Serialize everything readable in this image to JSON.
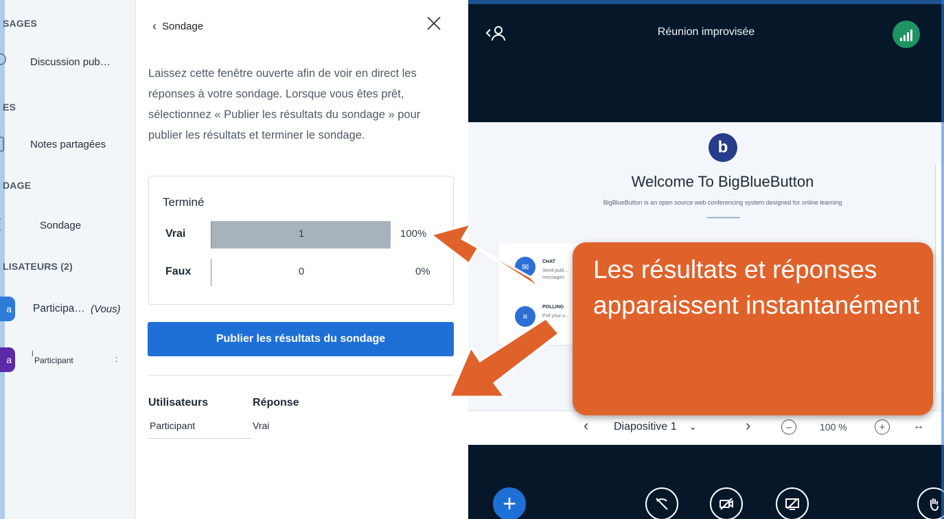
{
  "sidebar": {
    "sections": {
      "messages": "SAGES",
      "notes": "ES",
      "poll": "DAGE",
      "users": "LISATEURS (2)"
    },
    "items": {
      "public_chat": "Discussion pub…",
      "shared_notes": "Notes partagées",
      "poll": "Sondage"
    },
    "users": [
      {
        "initials": "a",
        "name": "Participa…",
        "suffix": "(Vous)",
        "color": "#2f7bd8"
      },
      {
        "initials": "a",
        "name": "Participant",
        "prefix": "l",
        "dots": ":",
        "color": "#5a2aa8"
      }
    ]
  },
  "poll_panel": {
    "back_label": "Sondage",
    "description": "Laissez cette fenêtre ouverte afin de voir en direct les réponses à votre sondage. Lorsque vous êtes prêt, sélectionnez « Publier les résultats du sondage » pour publier les résultats et terminer le sondage.",
    "status": "Terminé",
    "results": [
      {
        "label": "Vrai",
        "count": "1",
        "percent": "100%",
        "fraction": 1.0
      },
      {
        "label": "Faux",
        "count": "0",
        "percent": "0%",
        "fraction": 0.0
      }
    ],
    "publish_label": "Publier les résultats du sondage",
    "table": {
      "col_users": "Utilisateurs",
      "col_answer": "Réponse",
      "rows": [
        {
          "user": "Participant",
          "answer": "Vrai"
        }
      ]
    }
  },
  "meeting": {
    "title": "Réunion improvisée",
    "slide": {
      "title": "Welcome To BigBlueButton",
      "subtitle": "BigBlueButton is an open source web conferencing system designed for online learning",
      "features": [
        {
          "title": "CHAT",
          "text": "Send publ… messages"
        },
        {
          "title": "POLLING",
          "text": "Poll your u…"
        }
      ]
    },
    "controls": {
      "slide_label": "Diapositive 1",
      "zoom": "100 %"
    }
  },
  "annotation": {
    "text": "Les résultats et réponses apparaissent instantanément",
    "color": "#e0622b"
  },
  "colors": {
    "primary": "#1f70d6",
    "bar_fill": "#a7b3bc",
    "meeting_bg": "#06172a",
    "connection_ok": "#1d9462"
  }
}
